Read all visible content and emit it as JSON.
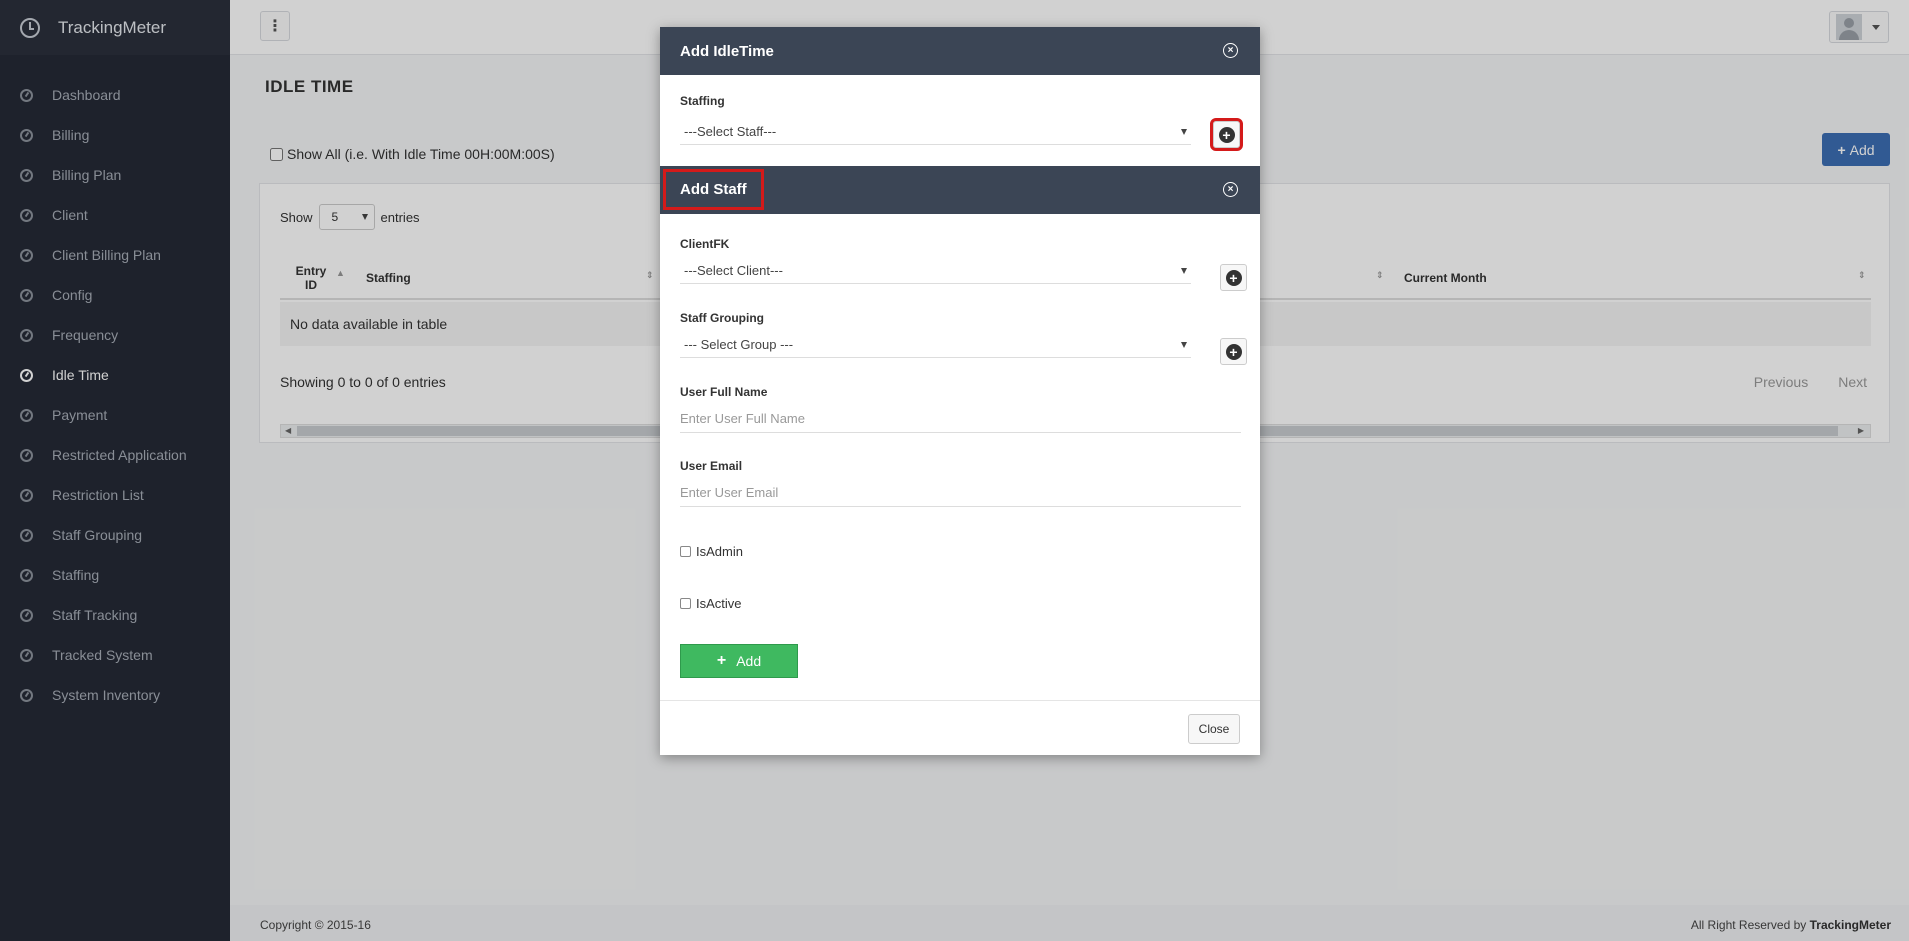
{
  "app": {
    "title": "TrackingMeter"
  },
  "sidebar": {
    "items": [
      {
        "label": "Dashboard"
      },
      {
        "label": "Billing"
      },
      {
        "label": "Billing Plan"
      },
      {
        "label": "Client"
      },
      {
        "label": "Client Billing Plan"
      },
      {
        "label": "Config"
      },
      {
        "label": "Frequency"
      },
      {
        "label": "Idle Time",
        "active": true
      },
      {
        "label": "Payment"
      },
      {
        "label": "Restricted Application"
      },
      {
        "label": "Restriction List"
      },
      {
        "label": "Staff Grouping"
      },
      {
        "label": "Staffing"
      },
      {
        "label": "Staff Tracking"
      },
      {
        "label": "Tracked System"
      },
      {
        "label": "System Inventory"
      }
    ]
  },
  "page": {
    "title": "IDLE TIME",
    "show_all_label": "Show All (i.e. With Idle Time 00H:00M:00S)",
    "add_label": "Add",
    "show_prefix": "Show",
    "show_suffix": "entries",
    "entries_value": "5",
    "columns": [
      "Entry ID",
      "Staffing",
      "Current Month"
    ],
    "no_data": "No data available in table",
    "showing": "Showing 0 to 0 of 0 entries",
    "previous": "Previous",
    "next": "Next"
  },
  "footer": {
    "copyright": "Copyright © 2015-16",
    "rights_prefix": "All Right Reserved by",
    "rights_brand": "TrackingMeter"
  },
  "modal_idle": {
    "title": "Add IdleTime",
    "staffing_label": "Staffing",
    "staffing_value": "---Select Staff---"
  },
  "modal_staff": {
    "title": "Add Staff",
    "client_label": "ClientFK",
    "client_value": "---Select Client---",
    "group_label": "Staff Grouping",
    "group_value": "--- Select Group ---",
    "name_label": "User Full Name",
    "name_placeholder": "Enter User Full Name",
    "email_label": "User Email",
    "email_placeholder": "Enter User Email",
    "isadmin_label": "IsAdmin",
    "isactive_label": "IsActive",
    "add_label": "Add",
    "close_label": "Close"
  },
  "colors": {
    "sidebar": "#252a36",
    "modal_header": "#3b4555",
    "primary": "#3c6eb4",
    "success": "#3fb960",
    "highlight": "#d41a1a"
  }
}
